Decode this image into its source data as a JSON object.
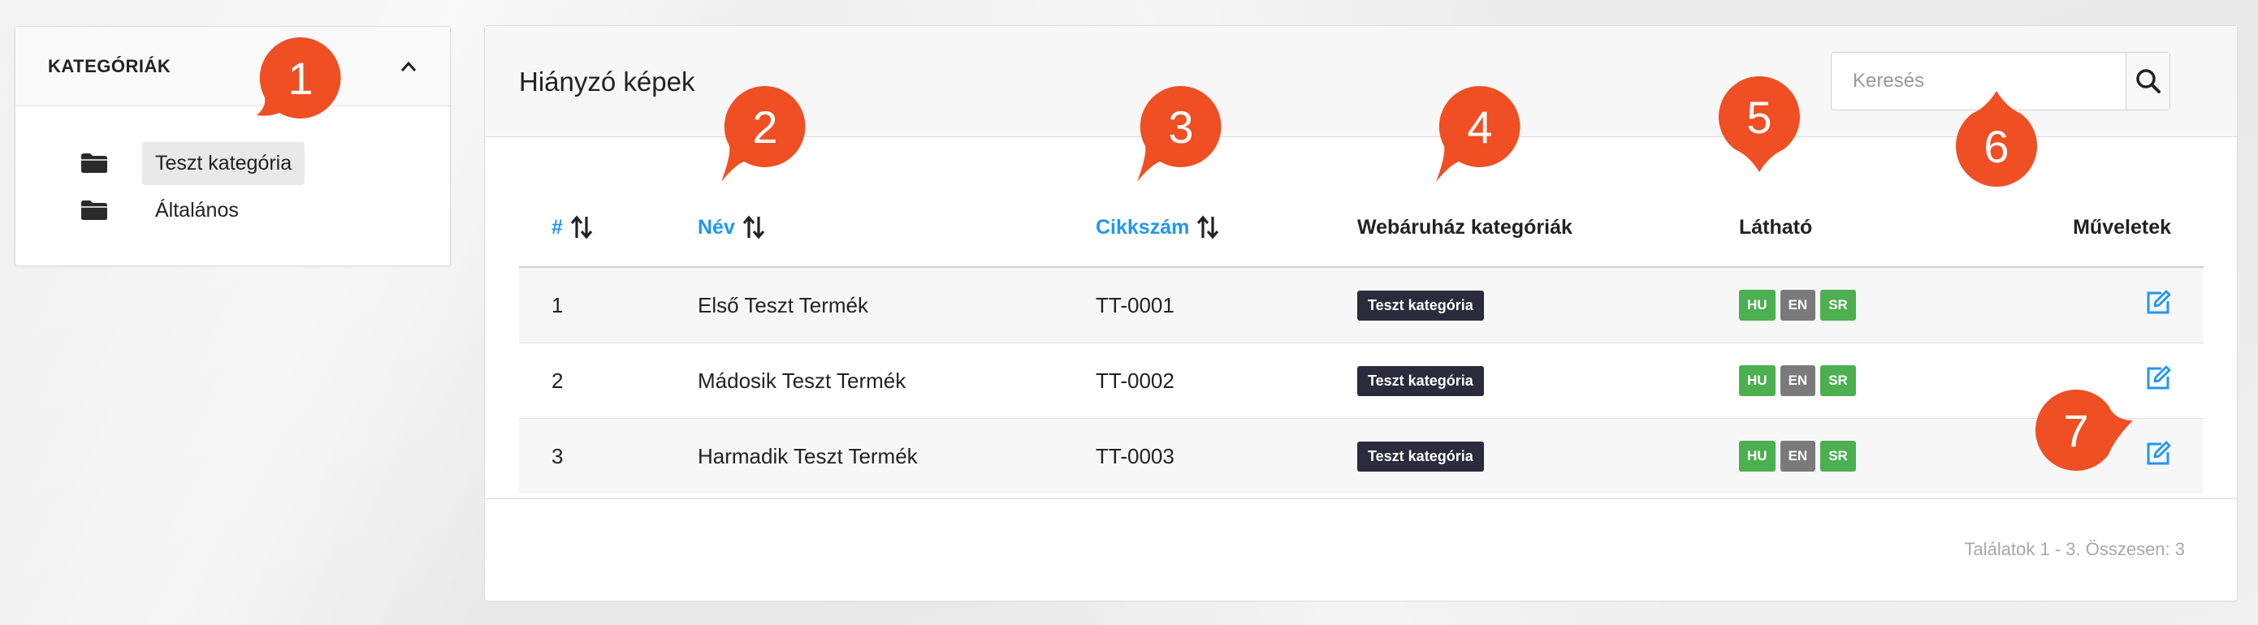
{
  "sidebar": {
    "title": "KATEGÓRIÁK",
    "items": [
      {
        "label": "Teszt kategória",
        "active": true
      },
      {
        "label": "Általános",
        "active": false
      }
    ]
  },
  "main": {
    "title": "Hiányzó képek",
    "search": {
      "placeholder": "Keresés",
      "value": ""
    },
    "table": {
      "columns": [
        {
          "label": "#",
          "sortable": true
        },
        {
          "label": "Név",
          "sortable": true
        },
        {
          "label": "Cikkszám",
          "sortable": true
        },
        {
          "label": "Webáruház kategóriák",
          "sortable": false
        },
        {
          "label": "Látható",
          "sortable": false
        },
        {
          "label": "Műveletek",
          "sortable": false
        }
      ],
      "rows": [
        {
          "id": "1",
          "name": "Első Teszt Termék",
          "sku": "TT-0001",
          "category": "Teszt kategória",
          "langs": [
            "HU",
            "EN",
            "SR"
          ]
        },
        {
          "id": "2",
          "name": "Mádosik Teszt Termék",
          "sku": "TT-0002",
          "category": "Teszt kategória",
          "langs": [
            "HU",
            "EN",
            "SR"
          ]
        },
        {
          "id": "3",
          "name": "Harmadik Teszt Termék",
          "sku": "TT-0003",
          "category": "Teszt kategória",
          "langs": [
            "HU",
            "EN",
            "SR"
          ]
        }
      ]
    },
    "summary": "Találatok 1 - 3. Összesen: 3"
  },
  "callouts": [
    "1",
    "2",
    "3",
    "4",
    "5",
    "6",
    "7"
  ],
  "colors": {
    "accent": "#2196f3",
    "callout": "#f04e23",
    "visible_on": "#4caf50",
    "visible_off": "#7a7a7a",
    "category_badge": "#2b2b3d"
  }
}
